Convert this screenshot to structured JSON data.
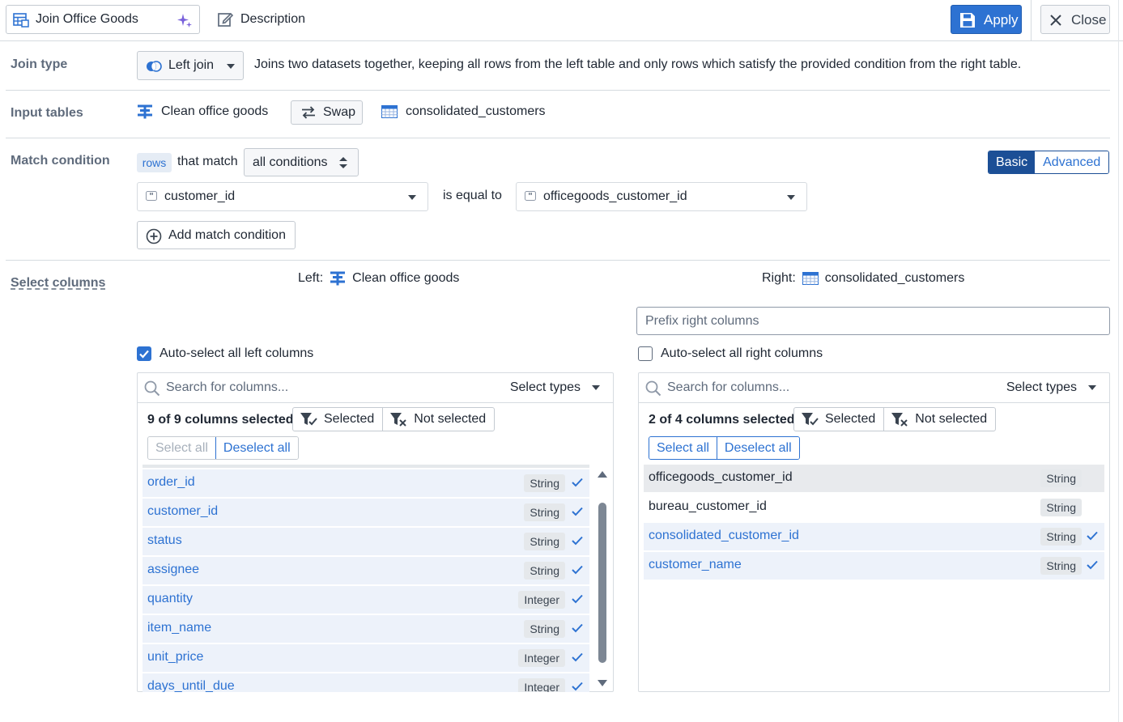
{
  "header": {
    "title": "Join Office Goods",
    "description_label": "Description",
    "apply_label": "Apply",
    "close_label": "Close"
  },
  "join_type": {
    "label": "Join type",
    "value": "Left join",
    "description": "Joins two datasets together, keeping all rows from the left table and only rows which satisfy the provided condition from the right table."
  },
  "input_tables": {
    "label": "Input tables",
    "left": "Clean office goods",
    "swap_label": "Swap",
    "right": "consolidated_customers"
  },
  "match_condition": {
    "label": "Match condition",
    "rows_tag": "rows",
    "that_match": "that match",
    "mode": "all conditions",
    "tabs": [
      "Basic",
      "Advanced"
    ],
    "active_tab": "Basic",
    "left_column": "customer_id",
    "operator": "is equal to",
    "right_column": "officegoods_customer_id",
    "add_label": "Add match condition"
  },
  "select_columns": {
    "label": "Select columns",
    "left_prefix": "Left:",
    "left_table": "Clean office goods",
    "right_prefix": "Right:",
    "right_table": "consolidated_customers",
    "prefix_placeholder": "Prefix right columns",
    "left": {
      "auto_select_label": "Auto-select all left columns",
      "auto_select_checked": true,
      "search_placeholder": "Search for columns...",
      "select_types": "Select types",
      "count_text": "9 of 9 columns selected",
      "filter_selected": "Selected",
      "filter_not_selected": "Not selected",
      "select_all": "Select all",
      "deselect_all": "Deselect all",
      "columns": [
        {
          "name": "order_id",
          "type": "String",
          "selected": true
        },
        {
          "name": "customer_id",
          "type": "String",
          "selected": true
        },
        {
          "name": "status",
          "type": "String",
          "selected": true
        },
        {
          "name": "assignee",
          "type": "String",
          "selected": true
        },
        {
          "name": "quantity",
          "type": "Integer",
          "selected": true
        },
        {
          "name": "item_name",
          "type": "String",
          "selected": true
        },
        {
          "name": "unit_price",
          "type": "Integer",
          "selected": true
        },
        {
          "name": "days_until_due",
          "type": "Integer",
          "selected": true
        }
      ]
    },
    "right": {
      "auto_select_label": "Auto-select all right columns",
      "auto_select_checked": false,
      "search_placeholder": "Search for columns...",
      "select_types": "Select types",
      "count_text": "2 of 4 columns selected",
      "filter_selected": "Selected",
      "filter_not_selected": "Not selected",
      "select_all": "Select all",
      "deselect_all": "Deselect all",
      "columns": [
        {
          "name": "officegoods_customer_id",
          "type": "String",
          "selected": false
        },
        {
          "name": "bureau_customer_id",
          "type": "String",
          "selected": false
        },
        {
          "name": "consolidated_customer_id",
          "type": "String",
          "selected": true
        },
        {
          "name": "customer_name",
          "type": "String",
          "selected": true
        }
      ]
    }
  },
  "colors": {
    "primary": "#2d72d2",
    "primary_dark": "#1c4f96",
    "selected_row": "#edf2fa",
    "label_gray": "#5f6b7c"
  }
}
